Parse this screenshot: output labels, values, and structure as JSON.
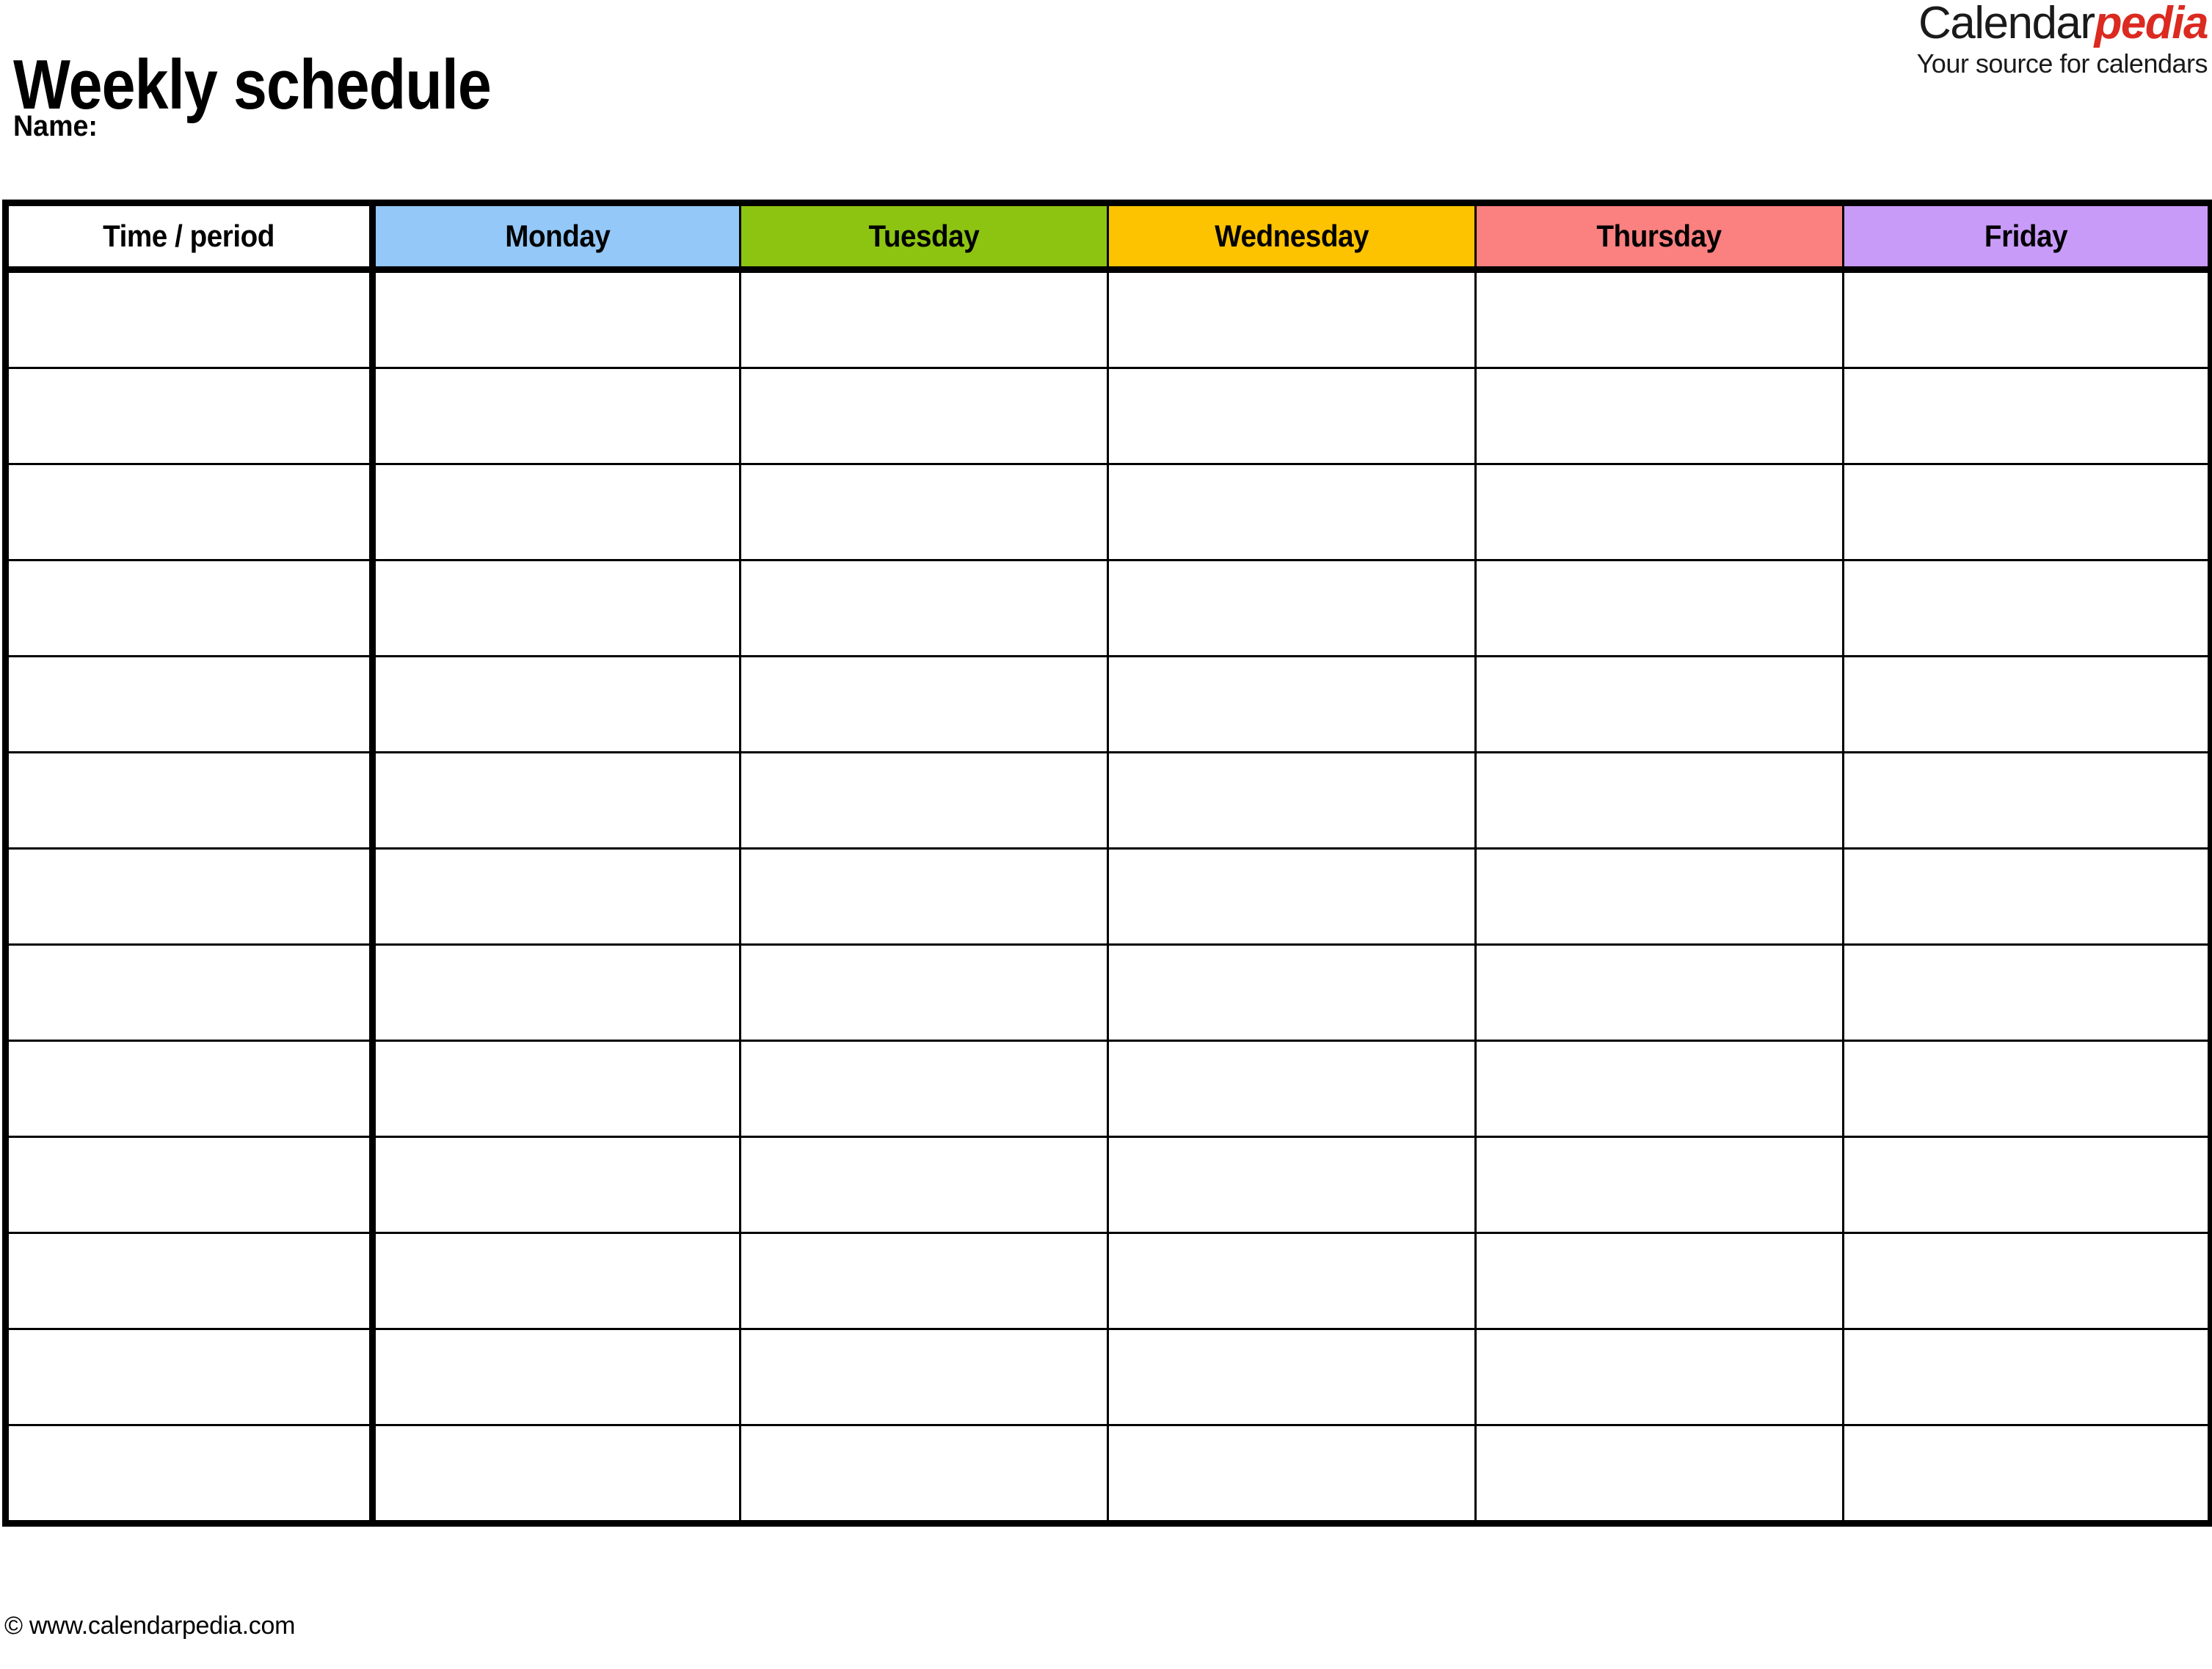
{
  "document": {
    "title": "Weekly schedule",
    "name_label": "Name:"
  },
  "brand": {
    "word_primary": "Calendar",
    "word_accent": "pedia",
    "tagline": "Your source for calendars",
    "accent_color": "#DB2A20"
  },
  "table": {
    "columns": [
      {
        "label": "Time / period",
        "bg": "#FFFFFF"
      },
      {
        "label": "Monday",
        "bg": "#93C8F8"
      },
      {
        "label": "Tuesday",
        "bg": "#8DC412"
      },
      {
        "label": "Wednesday",
        "bg": "#FDC300"
      },
      {
        "label": "Thursday",
        "bg": "#FB8080"
      },
      {
        "label": "Friday",
        "bg": "#C99BF9"
      }
    ],
    "row_count": 13,
    "rows": [
      {
        "time": "",
        "monday": "",
        "tuesday": "",
        "wednesday": "",
        "thursday": "",
        "friday": ""
      },
      {
        "time": "",
        "monday": "",
        "tuesday": "",
        "wednesday": "",
        "thursday": "",
        "friday": ""
      },
      {
        "time": "",
        "monday": "",
        "tuesday": "",
        "wednesday": "",
        "thursday": "",
        "friday": ""
      },
      {
        "time": "",
        "monday": "",
        "tuesday": "",
        "wednesday": "",
        "thursday": "",
        "friday": ""
      },
      {
        "time": "",
        "monday": "",
        "tuesday": "",
        "wednesday": "",
        "thursday": "",
        "friday": ""
      },
      {
        "time": "",
        "monday": "",
        "tuesday": "",
        "wednesday": "",
        "thursday": "",
        "friday": ""
      },
      {
        "time": "",
        "monday": "",
        "tuesday": "",
        "wednesday": "",
        "thursday": "",
        "friday": ""
      },
      {
        "time": "",
        "monday": "",
        "tuesday": "",
        "wednesday": "",
        "thursday": "",
        "friday": ""
      },
      {
        "time": "",
        "monday": "",
        "tuesday": "",
        "wednesday": "",
        "thursday": "",
        "friday": ""
      },
      {
        "time": "",
        "monday": "",
        "tuesday": "",
        "wednesday": "",
        "thursday": "",
        "friday": ""
      },
      {
        "time": "",
        "monday": "",
        "tuesday": "",
        "wednesday": "",
        "thursday": "",
        "friday": ""
      },
      {
        "time": "",
        "monday": "",
        "tuesday": "",
        "wednesday": "",
        "thursday": "",
        "friday": ""
      },
      {
        "time": "",
        "monday": "",
        "tuesday": "",
        "wednesday": "",
        "thursday": "",
        "friday": ""
      }
    ]
  },
  "footer": {
    "copyright": "© www.calendarpedia.com"
  }
}
